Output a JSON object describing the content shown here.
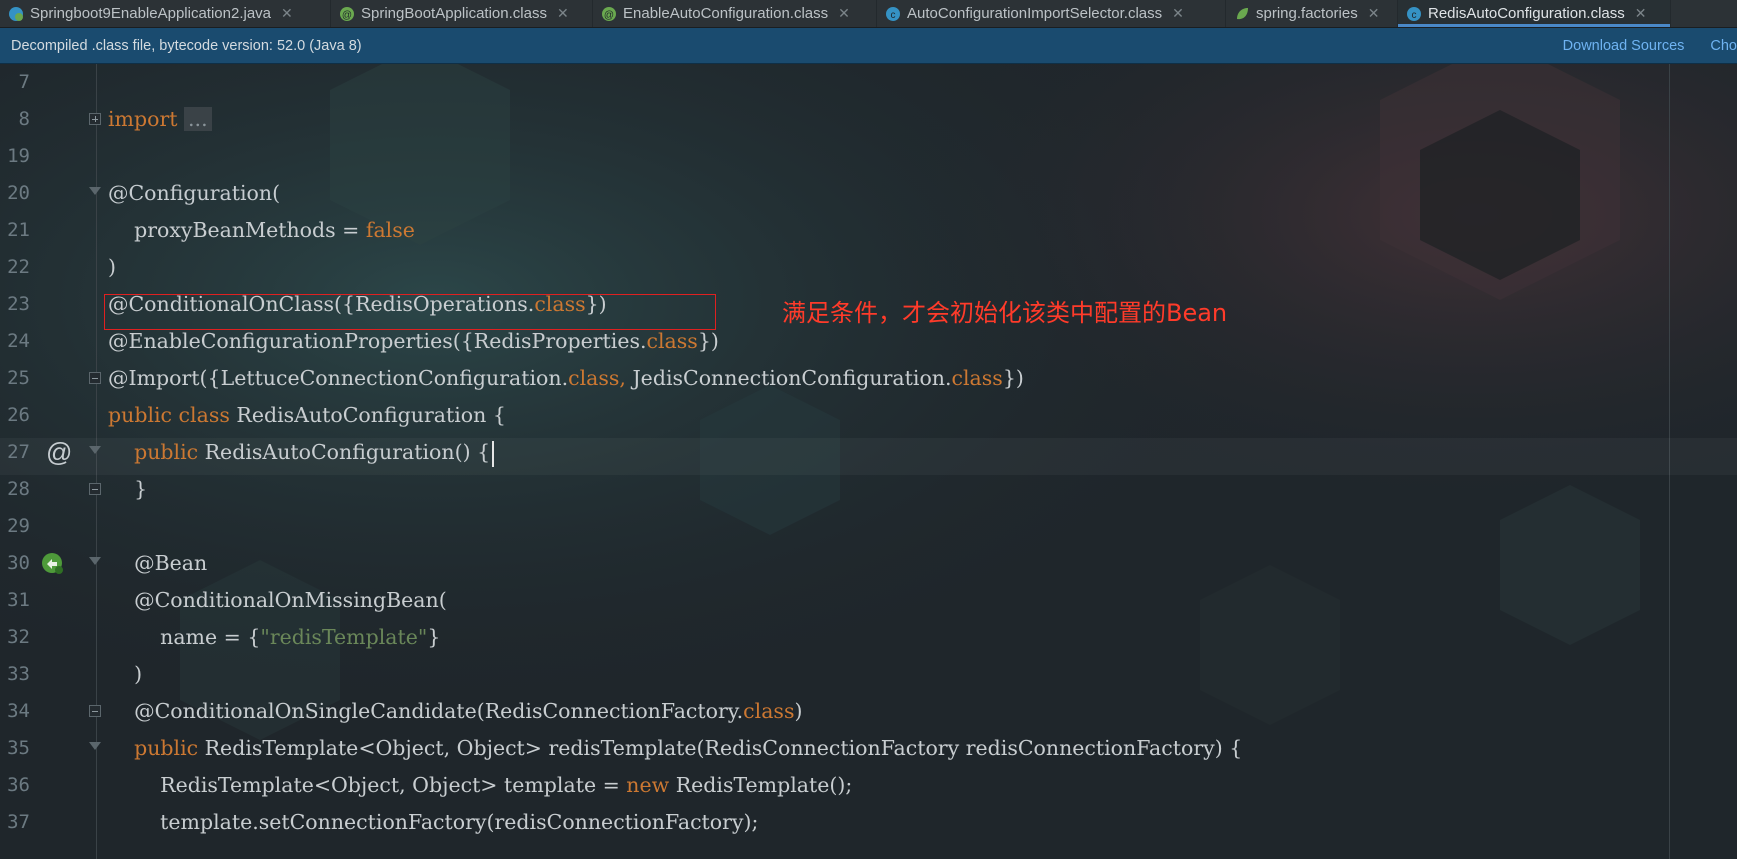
{
  "tabs": [
    {
      "label": "Springboot9EnableApplication2.java",
      "icon": "spring-class-icon",
      "active": false
    },
    {
      "label": "SpringBootApplication.class",
      "icon": "annotation-class-icon",
      "active": false
    },
    {
      "label": "EnableAutoConfiguration.class",
      "icon": "annotation-class-icon",
      "active": false
    },
    {
      "label": "AutoConfigurationImportSelector.class",
      "icon": "class-icon",
      "active": false
    },
    {
      "label": "spring.factories",
      "icon": "spring-leaf-icon",
      "active": false
    },
    {
      "label": "RedisAutoConfiguration.class",
      "icon": "class-icon",
      "active": true
    }
  ],
  "infobar": {
    "message": "Decompiled .class file, bytecode version: 52.0 (Java 8)",
    "download_sources": "Download Sources",
    "choose_sources": "Cho"
  },
  "annotation_note": "满足条件，才会初始化该类中配置的Bean",
  "gutter_icons": {
    "line27": "override-at-icon",
    "line30": "bean-navigation-icon"
  },
  "lines": [
    {
      "n": "7"
    },
    {
      "n": "8"
    },
    {
      "n": "19"
    },
    {
      "n": "20"
    },
    {
      "n": "21"
    },
    {
      "n": "22"
    },
    {
      "n": "23"
    },
    {
      "n": "24"
    },
    {
      "n": "25"
    },
    {
      "n": "26"
    },
    {
      "n": "27"
    },
    {
      "n": "28"
    },
    {
      "n": "29"
    },
    {
      "n": "30"
    },
    {
      "n": "31"
    },
    {
      "n": "32"
    },
    {
      "n": "33"
    },
    {
      "n": "34"
    },
    {
      "n": "35"
    },
    {
      "n": "36"
    },
    {
      "n": "37"
    }
  ],
  "code": {
    "l8_kw": "import",
    "l8_fold": "...",
    "l20": "@Configuration(",
    "l21_a": "    proxyBeanMethods = ",
    "l21_b": "false",
    "l22": ")",
    "l23_a": "@ConditionalOnClass({RedisOperations.",
    "l23_b": "class",
    "l23_c": "})",
    "l24_a": "@EnableConfigurationProperties({RedisProperties.",
    "l24_b": "class",
    "l24_c": "})",
    "l25_a": "@Import({LettuceConnectionConfiguration.",
    "l25_b": "class",
    "l25_c": ", ",
    "l25_d": "JedisConnectionConfiguration.",
    "l25_e": "class",
    "l25_f": "})",
    "l26_a": "public class ",
    "l26_b": "RedisAutoConfiguration {",
    "l27_a": "    public ",
    "l27_b": "RedisAutoConfiguration() {",
    "l28": "    }",
    "l30": "    @Bean",
    "l31": "    @ConditionalOnMissingBean(",
    "l32_a": "        name = {",
    "l32_b": "\"redisTemplate\"",
    "l32_c": "}",
    "l33": "    )",
    "l34_a": "    @ConditionalOnSingleCandidate(RedisConnectionFactory.",
    "l34_b": "class",
    "l34_c": ")",
    "l35_a": "    public ",
    "l35_b": "RedisTemplate<Object, Object> redisTemplate(RedisConnectionFactory redisConnectionFactory) {",
    "l36_a": "        RedisTemplate<Object, Object> template = ",
    "l36_b": "new ",
    "l36_c": "RedisTemplate();",
    "l37": "        template.setConnectionFactory(redisConnectionFactory);"
  },
  "colors": {
    "keyword": "#cc7832",
    "string": "#6a8759",
    "highlight_box": "#e02020",
    "note": "#ff3b2a",
    "infobar": "#1a4b6f",
    "active_tab_underline": "#4a88c7"
  }
}
